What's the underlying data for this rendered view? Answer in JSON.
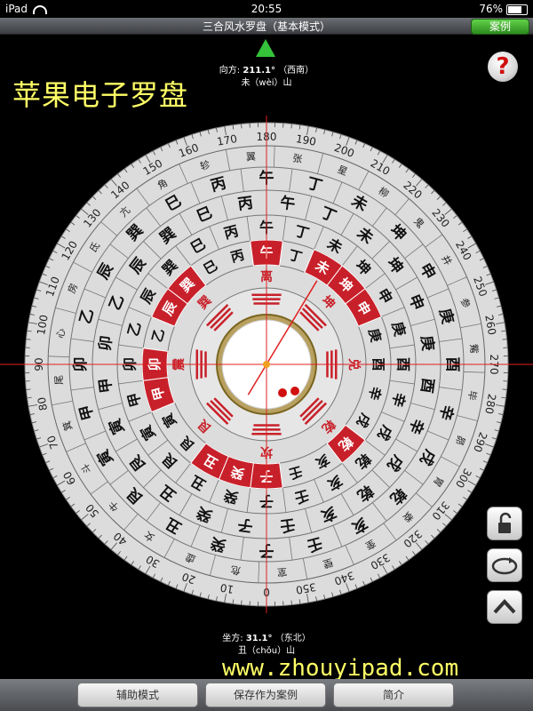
{
  "status_bar": {
    "device": "iPad",
    "time": "20:55",
    "battery": "76%"
  },
  "nav": {
    "title": "三合风水罗盘（基本模式）",
    "case_button": "案例"
  },
  "facing": {
    "label": "向方:",
    "degree": "211.1°",
    "direction": "（西南）",
    "mountain": "未（wèi）山"
  },
  "sitting": {
    "label": "坐方:",
    "degree": "31.1°",
    "direction": "（东北）",
    "mountain": "丑（chǒu）山"
  },
  "app_title": "苹果电子罗盘",
  "help_icon": "?",
  "website": "www.zhouyipad.com",
  "toolbar": {
    "assist": "辅助模式",
    "save": "保存作为案例",
    "intro": "简介"
  },
  "side_buttons": [
    "unlock-icon",
    "rotate-icon",
    "chevron-up-icon"
  ],
  "colors": {
    "accent_green": "#35c23a",
    "ring_red": "#c8202a",
    "title_yellow": "#ffff66",
    "pointer_red": "#e02020"
  },
  "compass": {
    "pointer_degree": 211.1,
    "outer_ticks": [
      0,
      10,
      20,
      30,
      40,
      50,
      60,
      70,
      80,
      90,
      100,
      110,
      120,
      130,
      140,
      150,
      160,
      170,
      180,
      190,
      200,
      210,
      220,
      230,
      240,
      250,
      260,
      270,
      280,
      290,
      300,
      310,
      320,
      330,
      340,
      350
    ],
    "mountains_24": [
      "子",
      "癸",
      "丑",
      "艮",
      "寅",
      "甲",
      "卯",
      "乙",
      "辰",
      "巽",
      "巳",
      "丙",
      "午",
      "丁",
      "未",
      "坤",
      "申",
      "庚",
      "酉",
      "辛",
      "戌",
      "乾",
      "亥",
      "壬"
    ],
    "trigrams_8": [
      "坎",
      "艮",
      "震",
      "巽",
      "离",
      "坤",
      "兑",
      "乾"
    ],
    "mansions_28": [
      "虚",
      "女",
      "牛",
      "斗",
      "箕",
      "尾",
      "心",
      "房",
      "氐",
      "亢",
      "角",
      "轸",
      "翼",
      "张",
      "星",
      "柳",
      "鬼",
      "井",
      "参",
      "觜",
      "毕",
      "昴",
      "胃",
      "娄",
      "奎",
      "壁",
      "室",
      "危"
    ]
  }
}
